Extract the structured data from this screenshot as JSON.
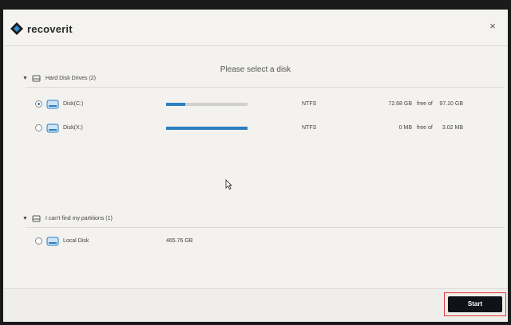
{
  "app": {
    "brand": "recoverit",
    "close_glyph": "×"
  },
  "prompt": "Please select a disk",
  "groups": [
    {
      "label": "Hard Disk Drives (2)",
      "disks": [
        {
          "name": "Disk(C:)",
          "usage_fraction": 0.24,
          "fs": "NTFS",
          "free": "72.68 GB",
          "free_of": "free of",
          "total": "97.10 GB",
          "selected": true
        },
        {
          "name": "Disk(X:)",
          "usage_fraction": 1.0,
          "fs": "NTFS",
          "free": "0 MB",
          "free_of": "free of",
          "total": "3.02 MB",
          "selected": false
        }
      ]
    },
    {
      "label": "I can't find my partitions (1)",
      "disks": [
        {
          "name": "Local Disk",
          "size": "465.76 GB",
          "selected": false
        }
      ]
    }
  ],
  "footer": {
    "start_label": "Start"
  },
  "colors": {
    "accent": "#2b7fc2",
    "button_bg": "#101218",
    "highlight_border": "#e03a3a"
  }
}
